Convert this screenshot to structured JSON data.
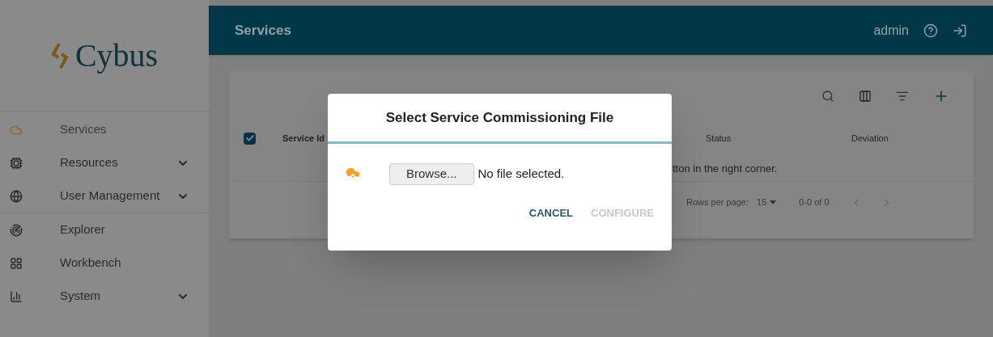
{
  "sidebar": {
    "logo": "Cybus",
    "groups": [
      {
        "items": [
          {
            "label": "Services",
            "selected": true,
            "expandable": false
          },
          {
            "label": "Resources",
            "selected": false,
            "expandable": true
          },
          {
            "label": "User Management",
            "selected": false,
            "expandable": true
          }
        ]
      },
      {
        "items": [
          {
            "label": "Explorer",
            "selected": false,
            "expandable": false
          },
          {
            "label": "Workbench",
            "selected": false,
            "expandable": false
          },
          {
            "label": "System",
            "selected": false,
            "expandable": true
          }
        ]
      }
    ]
  },
  "header": {
    "title": "Services",
    "user": "admin"
  },
  "table": {
    "select_all_checked": true,
    "columns": [
      "Service Id",
      "Status",
      "Deviation"
    ],
    "empty_message": "tton in the right corner.",
    "rows_per_page_label": "Rows per page:",
    "rows_per_page": "15",
    "range": "0-0 of 0"
  },
  "dialog": {
    "title": "Select Service Commissioning File",
    "browse_button": "Browse...",
    "file_status": "No file selected.",
    "buttons": [
      {
        "label": "CANCEL",
        "disabled": false
      },
      {
        "label": "CONFIGURE",
        "disabled": true
      }
    ]
  }
}
